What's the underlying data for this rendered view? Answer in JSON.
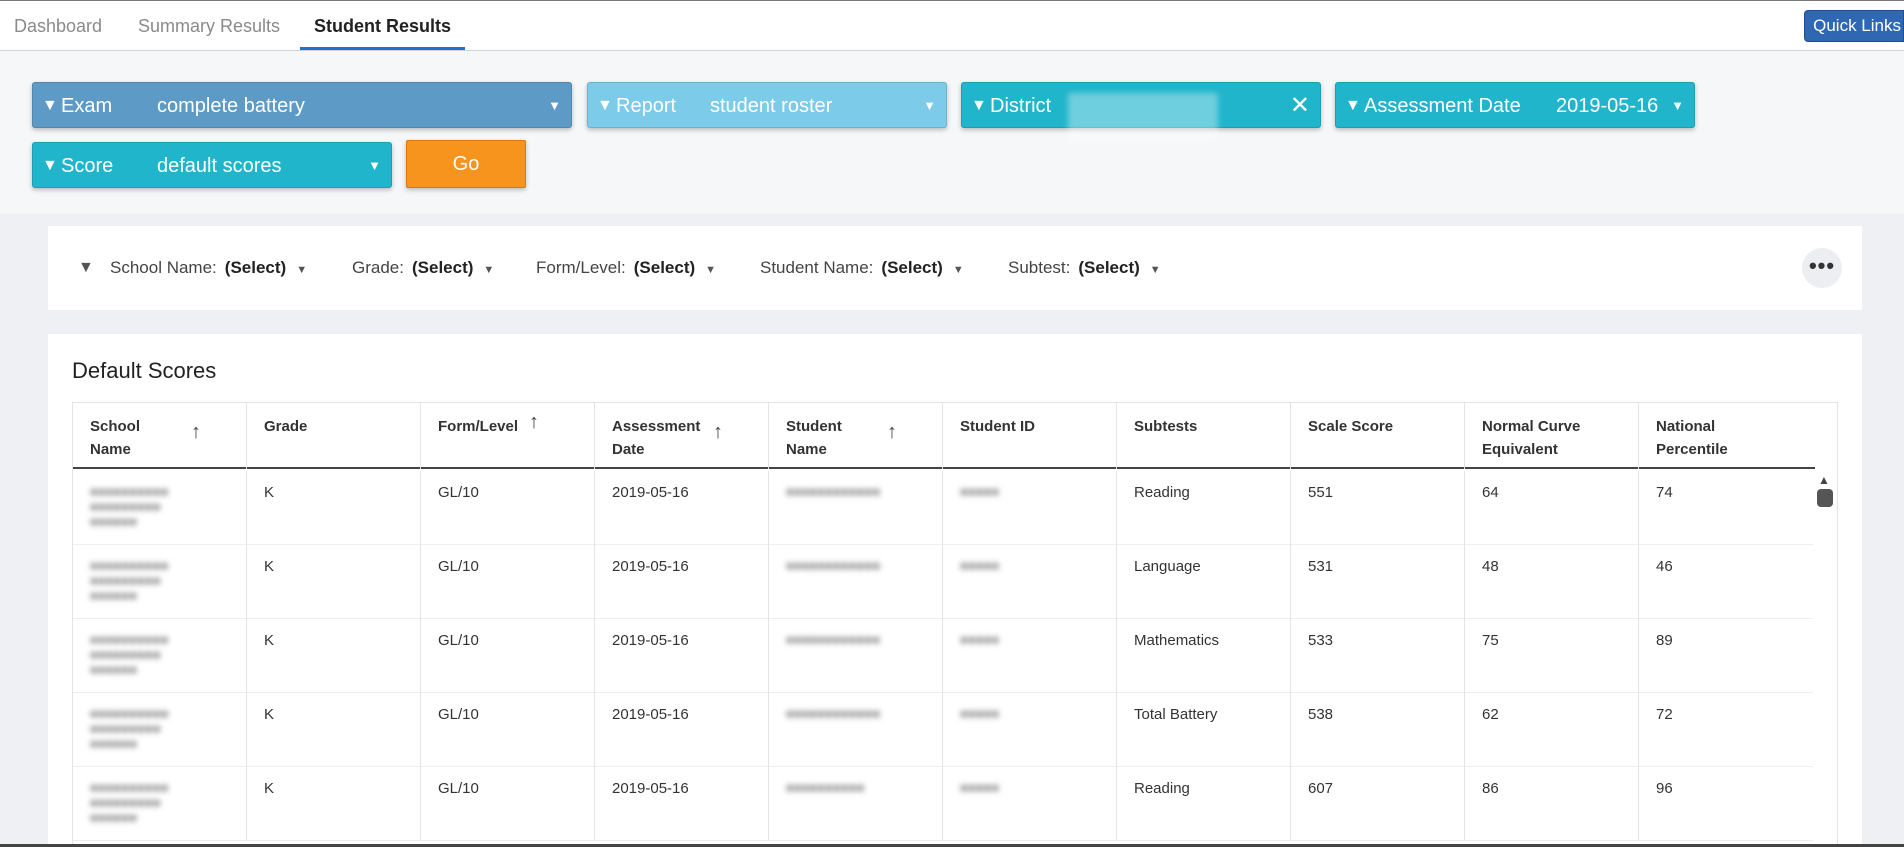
{
  "tabs": [
    "Dashboard",
    "Summary Results",
    "Student Results"
  ],
  "quick_links": "Quick Links",
  "filters": {
    "exam": {
      "label": "Exam",
      "value": "complete battery"
    },
    "report": {
      "label": "Report",
      "value": "student roster"
    },
    "district": {
      "label": "District",
      "value": "(redacted)"
    },
    "assessment_date": {
      "label": "Assessment Date",
      "value": "2019-05-16"
    },
    "score": {
      "label": "Score",
      "value": "default scores"
    },
    "go": "Go"
  },
  "sub_filters": {
    "school": {
      "label": "School Name:",
      "value": "(Select)"
    },
    "grade": {
      "label": "Grade:",
      "value": "(Select)"
    },
    "form": {
      "label": "Form/Level:",
      "value": "(Select)"
    },
    "student": {
      "label": "Student Name:",
      "value": "(Select)"
    },
    "subtest": {
      "label": "Subtest:",
      "value": "(Select)"
    },
    "more": "•••"
  },
  "results": {
    "title": "Default Scores",
    "columns": [
      "School Name",
      "Grade",
      "Form/Level",
      "Assessment Date",
      "Student Name",
      "Student ID",
      "Subtests",
      "Scale Score",
      "Normal Curve Equivalent",
      "National Percentile"
    ],
    "rows": [
      {
        "grade": "K",
        "form": "GL/10",
        "date": "2019-05-16",
        "subtest": "Reading",
        "scale": "551",
        "nce": "64",
        "np": "74"
      },
      {
        "grade": "K",
        "form": "GL/10",
        "date": "2019-05-16",
        "subtest": "Language",
        "scale": "531",
        "nce": "48",
        "np": "46"
      },
      {
        "grade": "K",
        "form": "GL/10",
        "date": "2019-05-16",
        "subtest": "Mathematics",
        "scale": "533",
        "nce": "75",
        "np": "89"
      },
      {
        "grade": "K",
        "form": "GL/10",
        "date": "2019-05-16",
        "subtest": "Total Battery",
        "scale": "538",
        "nce": "62",
        "np": "72"
      },
      {
        "grade": "K",
        "form": "GL/10",
        "date": "2019-05-16",
        "subtest": "Reading",
        "scale": "607",
        "nce": "86",
        "np": "96"
      }
    ]
  },
  "colors": {
    "teal": "#21b5cc",
    "slate_blue": "#5d9bc6",
    "light_blue": "#7ccbe8",
    "orange": "#f7941d",
    "tab_accent": "#1b74d1"
  }
}
